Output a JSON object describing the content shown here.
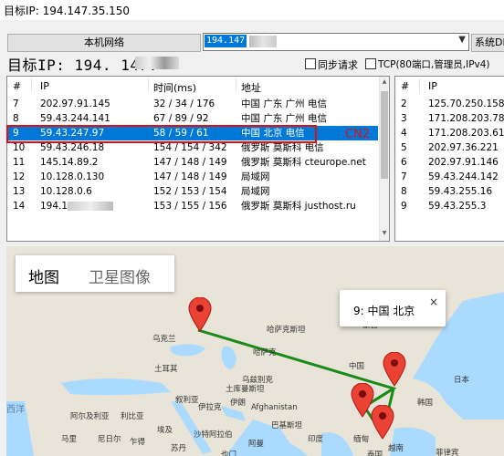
{
  "window": {
    "title": "目标IP: 194.147.35.150"
  },
  "controls": {
    "local_network_button": "本机网络",
    "destination_value": "194.147",
    "system_button": "系统DN",
    "target_label": "目标IP:  194. 147.",
    "sync_request_label": "同步请求",
    "tcp_label": "TCP(80端口,管理员,IPv4)",
    "sync_checked": false,
    "tcp_checked": false
  },
  "main_list": {
    "headers": [
      "#",
      "IP",
      "时间(ms)",
      "地址"
    ],
    "rows": [
      {
        "num": "7",
        "ip": "202.97.91.145",
        "time": "32 / 34 / 176",
        "addr": "中国 广东 广州 电信",
        "selected": false
      },
      {
        "num": "8",
        "ip": "59.43.244.141",
        "time": "67 / 89 / 92",
        "addr": "中国 广东 广州 电信",
        "selected": false
      },
      {
        "num": "9",
        "ip": "59.43.247.97",
        "time": "58 / 59 / 61",
        "addr": "中国 北京 电信",
        "selected": true
      },
      {
        "num": "10",
        "ip": "59.43.246.18",
        "time": "154 / 154 / 342",
        "addr": "俄罗斯 莫斯科 电信",
        "selected": false
      },
      {
        "num": "11",
        "ip": "145.14.89.2",
        "time": "147 / 148 / 149",
        "addr": "俄罗斯 莫斯科 cteurope.net",
        "selected": false
      },
      {
        "num": "12",
        "ip": "10.128.0.130",
        "time": "147 / 148 / 149",
        "addr": "局域网",
        "selected": false
      },
      {
        "num": "13",
        "ip": "10.128.0.6",
        "time": "152 / 153 / 154",
        "addr": "局域网",
        "selected": false
      },
      {
        "num": "14",
        "ip": "194.1",
        "time": "153 / 155 / 156",
        "addr": "俄罗斯 莫斯科 justhost.ru",
        "selected": false
      }
    ],
    "annotation": "CN2"
  },
  "side_list": {
    "headers": [
      "#",
      "IP"
    ],
    "rows": [
      {
        "num": "2",
        "ip": "125.70.250.158"
      },
      {
        "num": "3",
        "ip": "171.208.203.78"
      },
      {
        "num": "4",
        "ip": "171.208.203.61"
      },
      {
        "num": "5",
        "ip": "202.97.36.221"
      },
      {
        "num": "6",
        "ip": "202.97.91.146"
      },
      {
        "num": "7",
        "ip": "59.43.244.142"
      },
      {
        "num": "8",
        "ip": "59.43.255.16"
      },
      {
        "num": "9",
        "ip": "59.43.255.3"
      }
    ]
  },
  "map": {
    "tab_map": "地图",
    "tab_satellite": "卫星图像",
    "info_window_text": "9: 中国 北京",
    "info_close": "×",
    "route_color": "#1a8a1a",
    "marker_color": "#ea4335",
    "labels": {
      "ocean_left": "西洋",
      "afghanistan": "Afghanistan",
      "tarim": "土耳其",
      "china": "中国",
      "korea": "韩国",
      "syria": "叙利亚",
      "iraq": "伊拉克",
      "iran": "伊朗",
      "pakistan": "巴基斯坦",
      "egypt": "埃及",
      "saudi": "沙特阿拉伯",
      "india": "印度",
      "burma": "缅甸",
      "thailand": "泰国",
      "kazakh": "哈萨克斯坦",
      "mongolia": "蒙古",
      "vietnam": "越南",
      "mali": "马里",
      "niger": "尼日尔",
      "chad": "乍得",
      "sudan": "苏丹",
      "algeria": "阿尔及利亚",
      "libya": "利比亚",
      "ukraine": "乌克兰",
      "kz2": "哈萨克",
      "uzbek": "乌兹别克",
      "tm": "土库曼斯坦",
      "japan": "日本",
      "ph": "菲律宾",
      "yemen": "也门",
      "oman": "阿曼"
    }
  }
}
